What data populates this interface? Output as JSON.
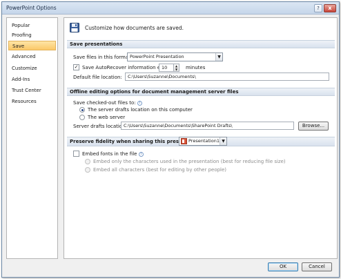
{
  "window": {
    "title": "PowerPoint Options",
    "help": "?",
    "close": "x"
  },
  "sidebar": {
    "items": [
      {
        "label": "Popular"
      },
      {
        "label": "Proofing"
      },
      {
        "label": "Save"
      },
      {
        "label": "Advanced"
      },
      {
        "label": "Customize"
      },
      {
        "label": "Add-Ins"
      },
      {
        "label": "Trust Center"
      },
      {
        "label": "Resources"
      }
    ],
    "selected": "Save"
  },
  "header": {
    "text": "Customize how documents are saved."
  },
  "save_presentations": {
    "title": "Save presentations",
    "format_label": "Save files in this format:",
    "format_value": "PowerPoint Presentation",
    "autorecover_label": "Save AutoRecover information every",
    "autorecover_checked": true,
    "autorecover_value": "10",
    "minutes_label": "minutes",
    "default_location_label": "Default file location:",
    "default_location_value": "C:\\Users\\Suzanne\\Documents\\"
  },
  "offline": {
    "title": "Offline editing options for document management server files",
    "checked_out_label": "Save checked-out files to:",
    "option_drafts": "The server drafts location on this computer",
    "option_web": "The web server",
    "selected": "option_drafts",
    "drafts_label": "Server drafts location:",
    "drafts_value": "C:\\Users\\Suzanne\\Documents\\SharePoint Drafts\\",
    "browse_label": "Browse..."
  },
  "fidelity": {
    "title": "Preserve fidelity when sharing this presentation:",
    "presentation_value": "Presentation1",
    "embed_label": "Embed fonts in the file",
    "embed_checked": false,
    "embed_only_label": "Embed only the characters used in the presentation (best for reducing file size)",
    "embed_all_label": "Embed all characters (best for editing by other people)"
  },
  "footer": {
    "ok": "OK",
    "cancel": "Cancel"
  },
  "colors": {
    "accent": "#fbc868",
    "section": "#d9e2ee",
    "window_border": "#6d8aa8"
  },
  "icons": {
    "header": "floppy-disk-icon",
    "info": "info-icon",
    "presentation": "powerpoint-file-icon"
  }
}
